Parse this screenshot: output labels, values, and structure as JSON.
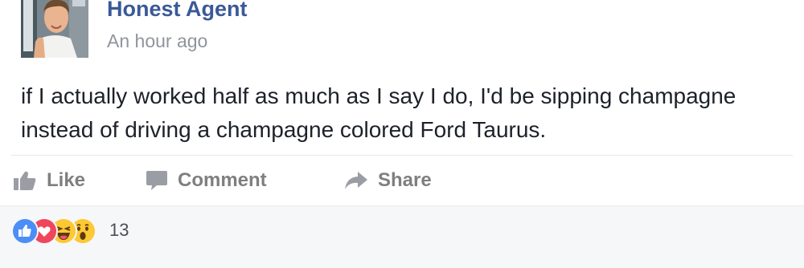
{
  "post": {
    "author": "Honest Agent",
    "timestamp": "An hour ago",
    "text": "if I actually worked half as much as I say I do, I'd be sipping champagne instead of driving a champagne colored Ford Taurus."
  },
  "actions": {
    "like_label": "Like",
    "like_icon": "thumbs-up-icon",
    "comment_label": "Comment",
    "comment_icon": "speech-bubble-icon",
    "share_label": "Share",
    "share_icon": "share-arrow-icon"
  },
  "reactions": {
    "types": [
      "like",
      "love",
      "haha",
      "wow"
    ],
    "count": "13"
  },
  "colors": {
    "author": "#3b5998",
    "muted": "#90949c",
    "action": "#7f7f7f",
    "like_blue": "#4c8ef7",
    "love_red": "#f0465c",
    "emoji_yellow": "#fcc934"
  }
}
